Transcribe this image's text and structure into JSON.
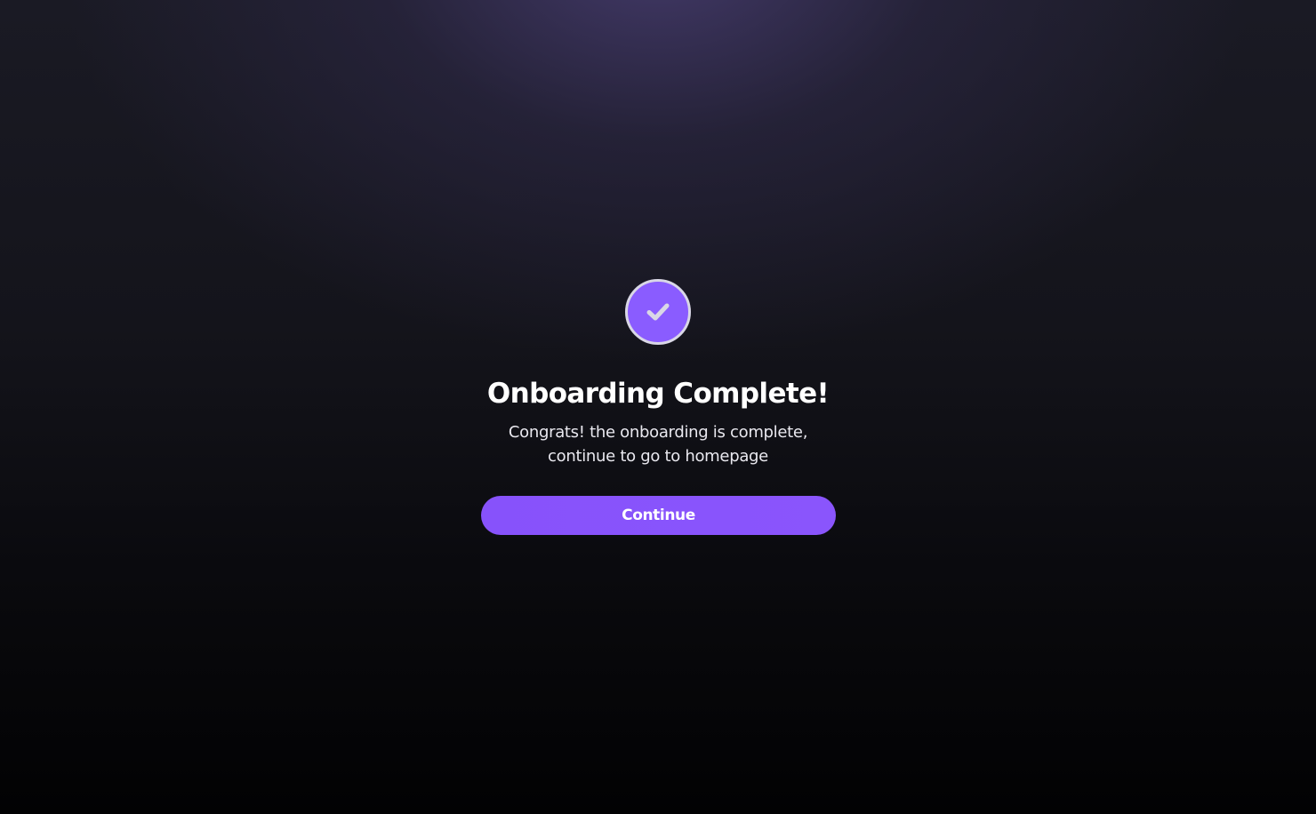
{
  "onboarding": {
    "status_icon": "check-circle-icon",
    "title": "Onboarding Complete!",
    "subtitle_line1": "Congrats! the onboarding is complete,",
    "subtitle_line2": "continue to go to homepage",
    "continue_label": "Continue"
  },
  "colors": {
    "accent": "#8752fb",
    "badge_border": "#d9d7e6",
    "checkmark": "#d9d7e6",
    "background_top": "#3a3456",
    "background_bottom": "#020203",
    "text_primary": "#ffffff"
  }
}
